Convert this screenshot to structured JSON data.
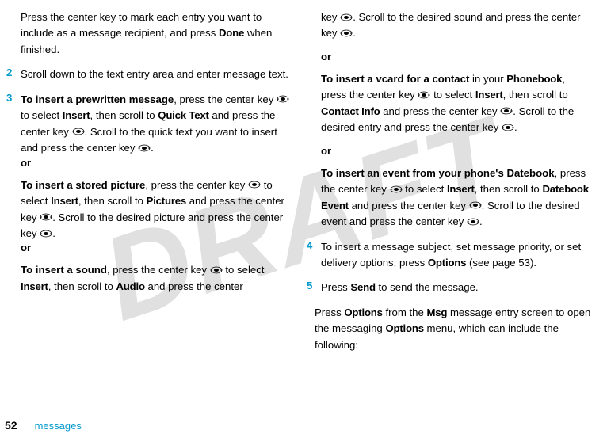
{
  "watermark": "DRAFT",
  "footer": {
    "page": "52",
    "section": "messages"
  },
  "left": {
    "p1a": "Press the center key to mark each entry you want to include as a message recipient, and press ",
    "p1b": "Done",
    "p1c": " when finished.",
    "step2": "2",
    "p2": "Scroll down to the text entry area and enter message text.",
    "step3": "3",
    "p3a": "To insert a prewritten message",
    "p3b": ", press the center key ",
    "p3c": " to select ",
    "p3d": "Insert",
    "p3e": ", then scroll to ",
    "p3f": "Quick Text",
    "p3g": " and press the center key ",
    "p3h": ". Scroll to the quick text you want to insert and press the center key ",
    "p3i": ".",
    "or": "or",
    "p4a": "To insert a stored picture",
    "p4b": ", press the center key ",
    "p4c": " to select ",
    "p4d": "Insert",
    "p4e": ", then scroll to ",
    "p4f": "Pictures",
    "p4g": " and press the center key ",
    "p4h": ". Scroll to the desired picture and press the center key ",
    "p4i": ".",
    "p5a": "To insert a sound",
    "p5b": ", press the center key ",
    "p5c": " to select ",
    "p5d": "Insert",
    "p5e": ", then scroll to ",
    "p5f": "Audio",
    "p5g": " and press the center "
  },
  "right": {
    "p1a": "key ",
    "p1b": ". Scroll to the desired sound and press the center key ",
    "p1c": ".",
    "or": "or",
    "p2a": "To insert a vcard for a contact",
    "p2b": " in your ",
    "p2c": "Phonebook",
    "p2d": ", press the center key ",
    "p2e": " to select ",
    "p2f": "Insert",
    "p2g": ", then scroll to ",
    "p2h": "Contact Info",
    "p2i": " and press the center key ",
    "p2j": ". Scroll to the desired entry and press the center key ",
    "p2k": ".",
    "p3a": "To insert an event from your phone's Datebook",
    "p3b": ", press the center key ",
    "p3c": " to select ",
    "p3d": "Insert",
    "p3e": ", then scroll to ",
    "p3f": "Datebook Event",
    "p3g": " and press the center key ",
    "p3h": ". Scroll to the desired event and press the center key ",
    "p3i": ".",
    "step4": "4",
    "p4a": "To insert a message subject, set message priority, or set delivery options, press ",
    "p4b": "Options",
    "p4c": " (see page 53).",
    "step5": "5",
    "p5a": "Press ",
    "p5b": "Send",
    "p5c": " to send the message.",
    "p6a": "Press ",
    "p6b": "Options",
    "p6c": " from the ",
    "p6d": "Msg",
    "p6e": " message entry screen to open the messaging ",
    "p6f": "Options",
    "p6g": " menu, which can include the following:"
  }
}
